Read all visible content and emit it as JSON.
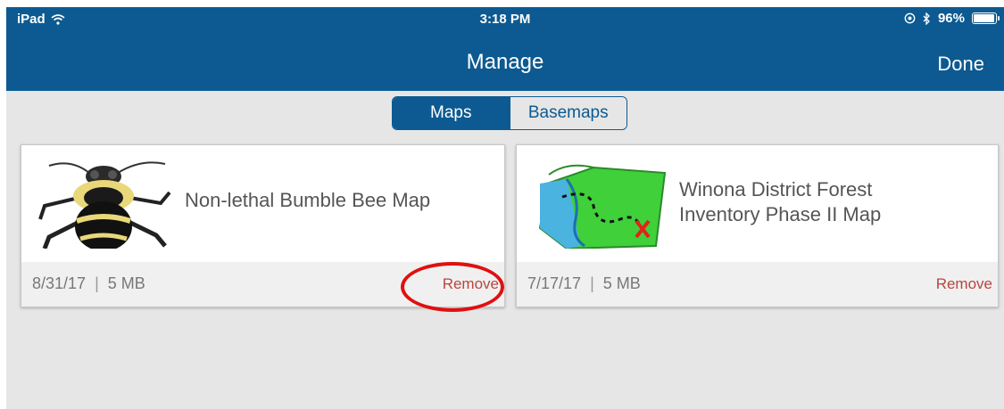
{
  "status_bar": {
    "device": "iPad",
    "time": "3:18 PM",
    "battery_percent": "96%",
    "battery_level": 0.96
  },
  "nav": {
    "title": "Manage",
    "done_label": "Done"
  },
  "segments": [
    {
      "label": "Maps",
      "selected": true
    },
    {
      "label": "Basemaps",
      "selected": false
    }
  ],
  "maps": [
    {
      "title": "Non-lethal Bumble Bee Map",
      "date": "8/31/17",
      "size": "5 MB",
      "remove_label": "Remove",
      "thumbnail_icon": "bumble-bee-illustration"
    },
    {
      "title_line1": "Winona District Forest",
      "title_line2": "Inventory Phase II Map",
      "date": "7/17/17",
      "size": "5 MB",
      "remove_label": "Remove",
      "thumbnail_icon": "treasure-map-illustration"
    }
  ],
  "colors": {
    "nav_bar": "#0c5a91",
    "background": "#e6e6e6",
    "remove_text": "#b8463f",
    "annotation_ring": "#e01010"
  }
}
